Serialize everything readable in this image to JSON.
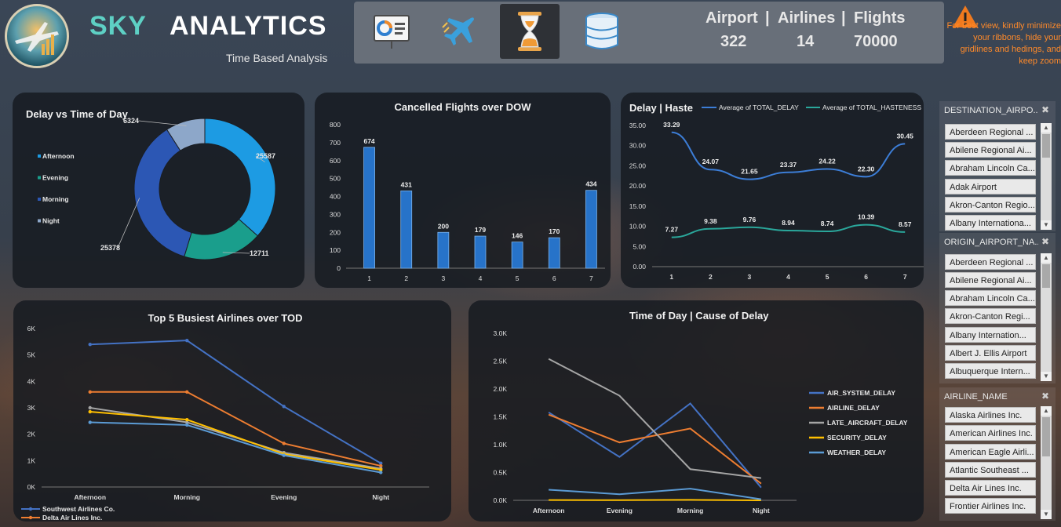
{
  "header": {
    "brand_part1": "SKY",
    "brand_part2": "ANALYTICS",
    "subtitle": "Time Based Analysis",
    "nav": [
      {
        "icon": "presentation-chart-icon"
      },
      {
        "icon": "airplane-icon"
      },
      {
        "icon": "hourglass-icon",
        "active": true
      },
      {
        "icon": "database-icon"
      }
    ],
    "stats": {
      "airport_label": "Airport",
      "airline_label": "Airlines",
      "flights_label": "Flights",
      "sep": "|",
      "airport_value": "322",
      "airline_value": "14",
      "flights_value": "70000"
    },
    "notice": "For best view, kindly  minimize your ribbons, hide your gridlines and hedings, and keep zoom"
  },
  "colors": {
    "accent": "#5ed0c4",
    "warning": "#ff8a2a",
    "panel": "#161a20"
  },
  "chart_data": [
    {
      "type": "pie",
      "title": "Delay vs Time of Day",
      "categories": [
        "Afternoon",
        "Evening",
        "Morning",
        "Night"
      ],
      "values": [
        25587,
        12711,
        25378,
        6324
      ],
      "colors": [
        "#1d9be3",
        "#1a9e8c",
        "#2c57b4",
        "#8da7c9"
      ],
      "legend": "left"
    },
    {
      "type": "bar",
      "title": "Cancelled Flights over DOW",
      "categories": [
        "1",
        "2",
        "3",
        "4",
        "5",
        "6",
        "7"
      ],
      "values": [
        674,
        431,
        200,
        179,
        146,
        170,
        434
      ],
      "ylim": [
        0,
        800
      ],
      "yticks": [
        0,
        100,
        200,
        300,
        400,
        500,
        600,
        700,
        800
      ]
    },
    {
      "type": "line",
      "title": "Delay | Haste",
      "categories": [
        "1",
        "2",
        "3",
        "4",
        "5",
        "6",
        "7"
      ],
      "series": [
        {
          "name": "Average of TOTAL_DELAY",
          "values": [
            33.29,
            24.07,
            21.65,
            23.37,
            24.22,
            22.3,
            30.45
          ],
          "color": "#3c7dd6"
        },
        {
          "name": "Average of TOTAL_HASTENESS",
          "values": [
            7.27,
            9.38,
            9.76,
            8.94,
            8.74,
            10.39,
            8.57
          ],
          "color": "#2aa79b"
        }
      ],
      "ylim": [
        0,
        35
      ],
      "yticks": [
        "0.00",
        "5.00",
        "10.00",
        "15.00",
        "20.00",
        "25.00",
        "30.00",
        "35.00"
      ],
      "legend": "top"
    },
    {
      "type": "line",
      "title": "Top 5 Busiest Airlines over TOD",
      "categories": [
        "Afternoon",
        "Morning",
        "Evening",
        "Night"
      ],
      "series": [
        {
          "name": "Southwest Airlines Co.",
          "values": [
            5400,
            5550,
            3050,
            900
          ],
          "color": "#4472c4"
        },
        {
          "name": "Delta Air Lines Inc.",
          "values": [
            3600,
            3600,
            1650,
            800
          ],
          "color": "#ed7d31"
        },
        {
          "values": [
            3000,
            2450,
            1300,
            700
          ],
          "color": "#a5a5a5"
        },
        {
          "values": [
            2850,
            2550,
            1250,
            650
          ],
          "color": "#ffc000"
        },
        {
          "values": [
            2450,
            2350,
            1200,
            550
          ],
          "color": "#5b9bd5"
        }
      ],
      "ylim": [
        0,
        6000
      ],
      "yticks": [
        "0K",
        "1K",
        "2K",
        "3K",
        "4K",
        "5K",
        "6K"
      ],
      "legend": "bottom"
    },
    {
      "type": "line",
      "title": "Time of Day | Cause of Delay",
      "categories": [
        "Afternoon",
        "Evening",
        "Morning",
        "Night"
      ],
      "series": [
        {
          "name": "AIR_SYSTEM_DELAY",
          "values": [
            1580,
            780,
            1740,
            230
          ],
          "color": "#4472c4"
        },
        {
          "name": "AIRLINE_DELAY",
          "values": [
            1540,
            1040,
            1290,
            300
          ],
          "color": "#ed7d31"
        },
        {
          "name": "LATE_AIRCRAFT_DELAY",
          "values": [
            2540,
            1880,
            560,
            400
          ],
          "color": "#a5a5a5"
        },
        {
          "name": "SECURITY_DELAY",
          "values": [
            5,
            3,
            8,
            0
          ],
          "color": "#ffc000"
        },
        {
          "name": "WEATHER_DELAY",
          "values": [
            190,
            110,
            210,
            20
          ],
          "color": "#5b9bd5"
        }
      ],
      "ylim": [
        0,
        3000
      ],
      "yticks": [
        "0.0K",
        "0.5K",
        "1.0K",
        "1.5K",
        "2.0K",
        "2.5K",
        "3.0K"
      ],
      "legend": "right"
    }
  ],
  "slicers": [
    {
      "title": "DESTINATION_AIRPO...",
      "items": [
        "Aberdeen Regional ...",
        "Abilene Regional Ai...",
        "Abraham Lincoln Ca...",
        "Adak Airport",
        "Akron-Canton Regio...",
        "Albany Internationa..."
      ]
    },
    {
      "title": "ORIGIN_AIRPORT_NA...",
      "items": [
        "Aberdeen Regional ...",
        "Abilene Regional Ai...",
        "Abraham Lincoln Ca...",
        "Akron-Canton Regi...",
        "Albany Internation...",
        "Albert J. Ellis Airport",
        "Albuquerque Intern..."
      ]
    },
    {
      "title": "AIRLINE_NAME",
      "items": [
        "Alaska Airlines Inc.",
        "American Airlines Inc.",
        "American Eagle Airli...",
        "Atlantic Southeast ...",
        "Delta Air Lines Inc.",
        "Frontier Airlines Inc."
      ]
    }
  ]
}
